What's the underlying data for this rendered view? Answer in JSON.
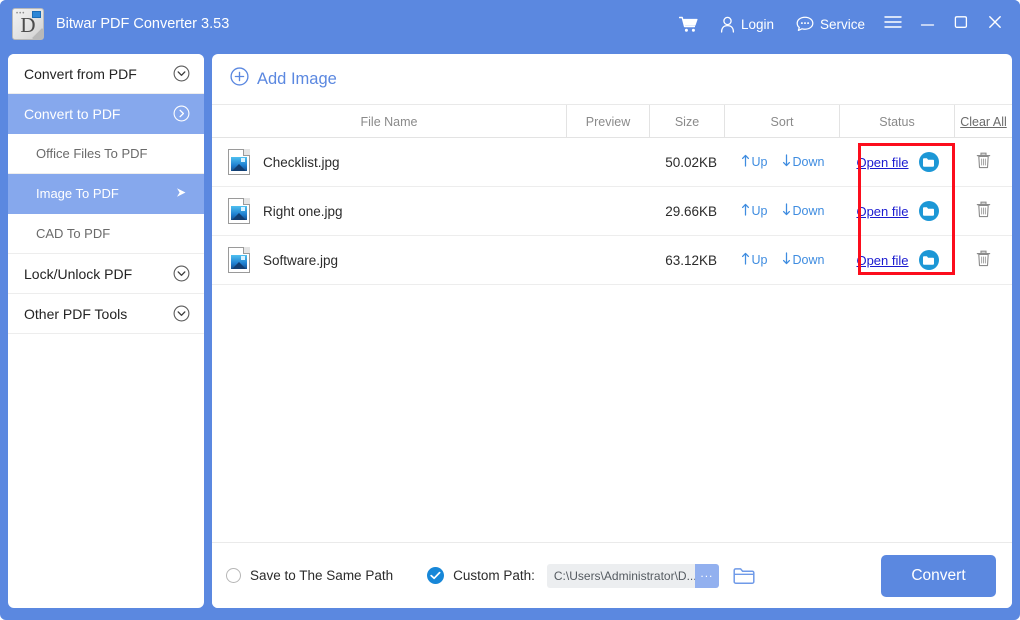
{
  "window": {
    "title": "Bitwar PDF Converter 3.53",
    "logo_icon": "app-logo-document-d-icon",
    "accent_color": "#5b88e0",
    "selected_color": "#86a8ed",
    "annotation_color": "#fc0d1c"
  },
  "titlebar": {
    "cart_icon": "shopping-cart-icon",
    "login_label": "Login",
    "login_icon": "user-icon",
    "service_label": "Service",
    "service_icon": "chat-bubble-icon",
    "menu_icon": "hamburger-menu-icon",
    "minimize_icon": "minimize-icon",
    "maximize_icon": "maximize-icon",
    "close_icon": "close-icon"
  },
  "sidebar": {
    "items": [
      {
        "label": "Convert from PDF",
        "type": "group",
        "active": false,
        "icon": "chevron-down-circle-icon"
      },
      {
        "label": "Convert to PDF",
        "type": "group",
        "active": true,
        "icon": "chevron-right-circle-icon"
      },
      {
        "label": "Office Files To PDF",
        "type": "sub",
        "active": false,
        "icon": ""
      },
      {
        "label": "Image To PDF",
        "type": "sub",
        "active": true,
        "icon": "arrow-right-icon"
      },
      {
        "label": "CAD To PDF",
        "type": "sub",
        "active": false,
        "icon": ""
      },
      {
        "label": "Lock/Unlock PDF",
        "type": "group",
        "active": false,
        "icon": "chevron-down-circle-icon"
      },
      {
        "label": "Other PDF Tools",
        "type": "group",
        "active": false,
        "icon": "chevron-down-circle-icon"
      }
    ]
  },
  "main": {
    "toolbar": {
      "add_label": "Add Image",
      "add_icon": "plus-circle-icon"
    },
    "table": {
      "headers": {
        "file_name": "File Name",
        "preview": "Preview",
        "size": "Size",
        "sort": "Sort",
        "status": "Status",
        "clear_all": "Clear All"
      },
      "row_labels": {
        "up": "Up",
        "down": "Down",
        "open_file": "Open file",
        "up_icon": "arrow-up-icon",
        "down_icon": "arrow-down-icon",
        "folder_icon": "folder-circle-icon",
        "delete_icon": "trash-icon",
        "file_icon": "image-file-icon"
      },
      "rows": [
        {
          "name": "Checklist.jpg",
          "preview": "",
          "size": "50.02KB"
        },
        {
          "name": "Right one.jpg",
          "preview": "",
          "size": "29.66KB"
        },
        {
          "name": "Software.jpg",
          "preview": "",
          "size": "63.12KB"
        }
      ]
    },
    "bottom": {
      "same_path_label": "Save to The Same Path",
      "same_path_selected": false,
      "custom_path_label": "Custom Path:",
      "custom_path_selected": true,
      "check_icon": "check-circle-icon",
      "path_value": "C:\\Users\\Administrator\\D...",
      "browse_label": "...",
      "open_folder_icon": "folder-open-icon",
      "convert_label": "Convert"
    }
  }
}
